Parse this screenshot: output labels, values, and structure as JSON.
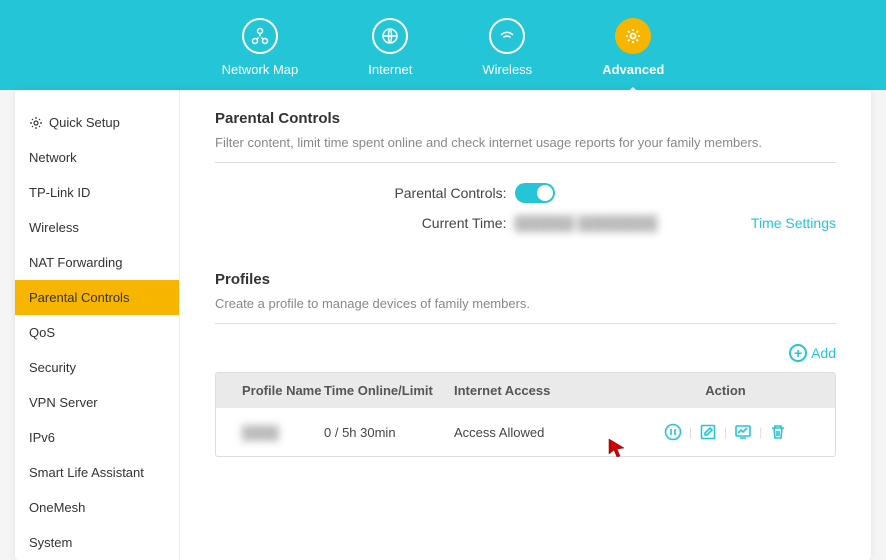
{
  "nav": {
    "items": [
      {
        "label": "Network Map"
      },
      {
        "label": "Internet"
      },
      {
        "label": "Wireless"
      },
      {
        "label": "Advanced"
      }
    ]
  },
  "sidebar": {
    "items": [
      {
        "label": "Quick Setup"
      },
      {
        "label": "Network"
      },
      {
        "label": "TP-Link ID"
      },
      {
        "label": "Wireless"
      },
      {
        "label": "NAT Forwarding"
      },
      {
        "label": "Parental Controls"
      },
      {
        "label": "QoS"
      },
      {
        "label": "Security"
      },
      {
        "label": "VPN Server"
      },
      {
        "label": "IPv6"
      },
      {
        "label": "Smart Life Assistant"
      },
      {
        "label": "OneMesh"
      },
      {
        "label": "System"
      }
    ]
  },
  "parental": {
    "title": "Parental Controls",
    "desc": "Filter content, limit time spent online and check internet usage reports for your family members.",
    "toggle_label": "Parental Controls:",
    "time_label": "Current Time:",
    "time_value": "██████ ████████",
    "time_settings": "Time Settings"
  },
  "profiles": {
    "title": "Profiles",
    "desc": "Create a profile to manage devices of family members.",
    "add_label": "Add",
    "headers": {
      "name": "Profile Name",
      "time": "Time Online/Limit",
      "access": "Internet Access",
      "action": "Action"
    },
    "rows": [
      {
        "name": "████",
        "time": "0 / 5h 30min",
        "access": "Access Allowed"
      }
    ]
  }
}
